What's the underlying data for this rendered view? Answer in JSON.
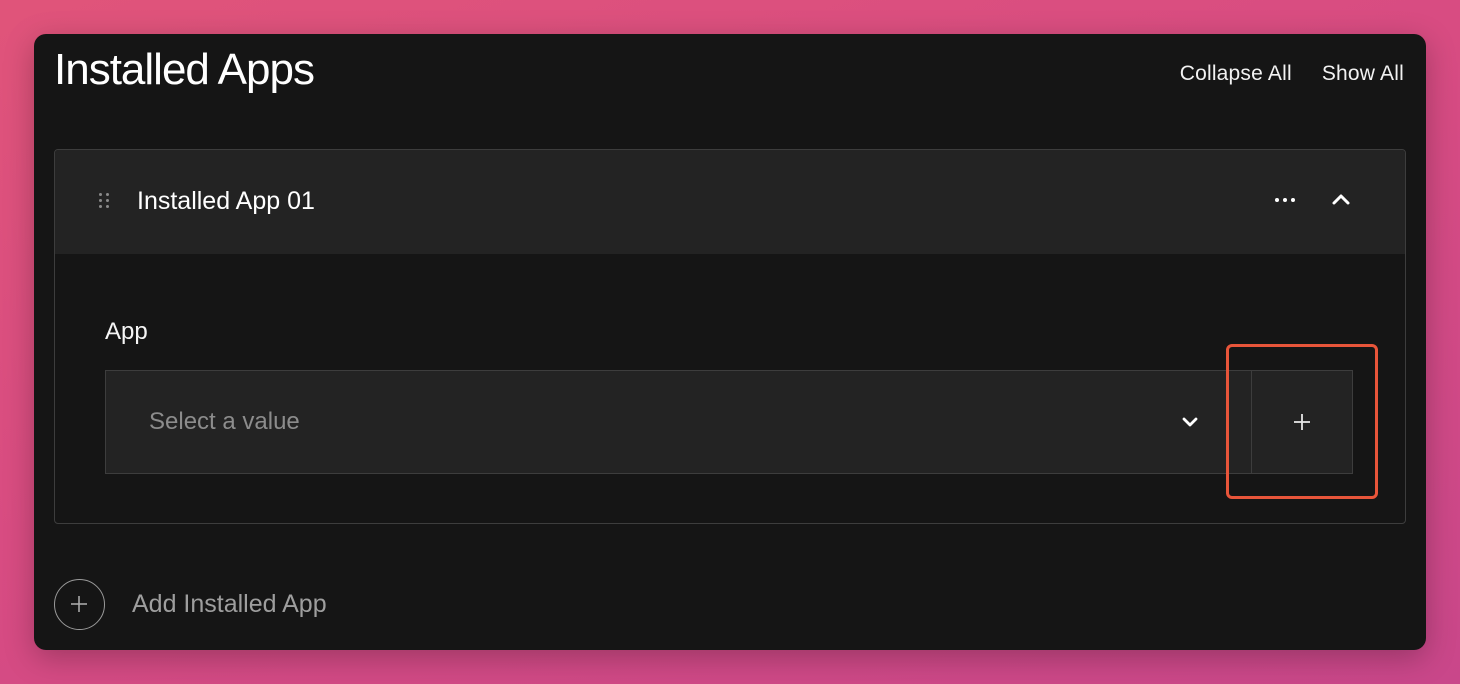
{
  "header": {
    "title": "Installed Apps",
    "collapse_all_label": "Collapse All",
    "show_all_label": "Show All"
  },
  "item": {
    "title": "Installed App 01",
    "field_label": "App",
    "select_placeholder": "Select a value",
    "add_value_glyph": "+"
  },
  "footer": {
    "add_label": "Add Installed App"
  },
  "icons": {
    "drag": "drag-handle-icon",
    "more": "more-horizontal-icon",
    "collapse": "chevron-up-icon",
    "select": "chevron-down-icon",
    "add": "plus-icon",
    "add_circle": "plus-circle-icon"
  },
  "colors": {
    "background": "#d84c82",
    "panel": "#151515",
    "surface": "#232323",
    "border": "#3d3d3d",
    "highlight": "#e8553a"
  }
}
